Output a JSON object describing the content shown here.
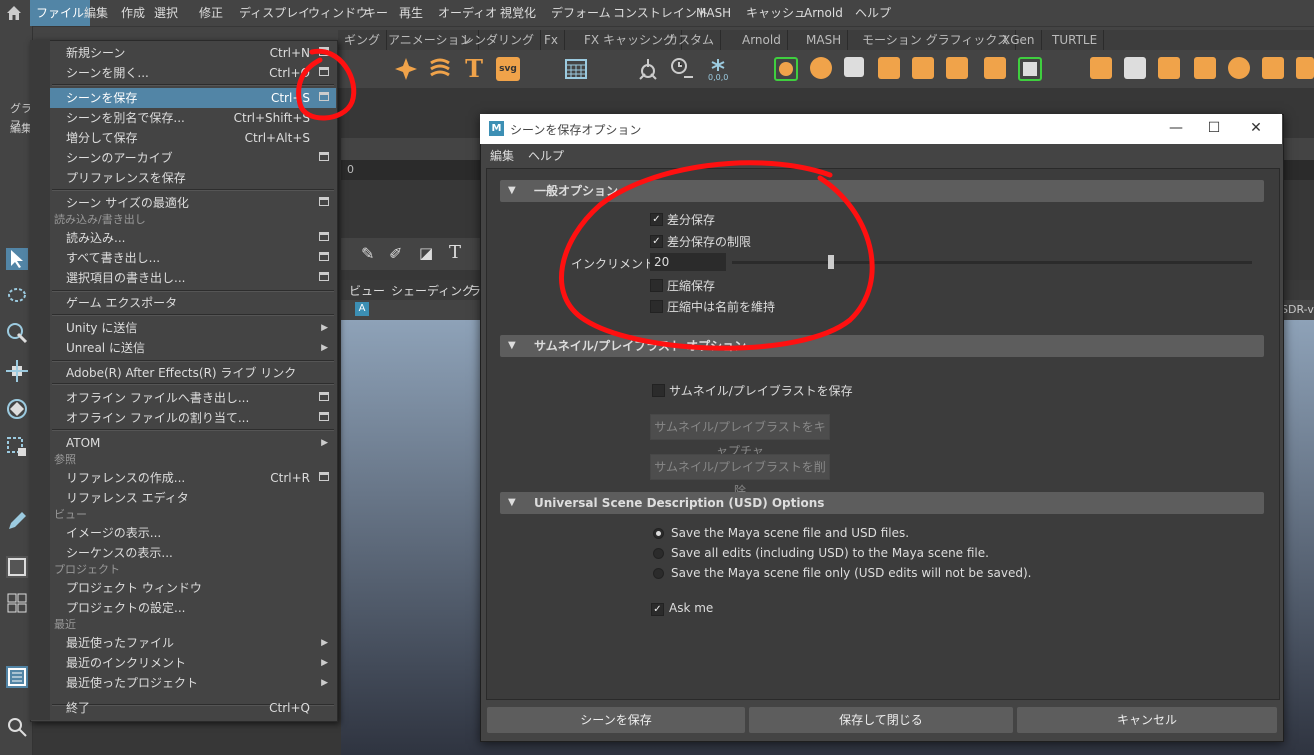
{
  "menubar": {
    "items": [
      "ファイル",
      "編集",
      "作成",
      "選択",
      "修正",
      "ディスプレイ",
      "ウィンドウ",
      "キー",
      "再生",
      "オーディオ",
      "視覚化",
      "デフォーム",
      "コンストレイント",
      "MASH",
      "キャッシュ",
      "Arnold",
      "ヘルプ"
    ]
  },
  "shelf_tabs": [
    "ギング",
    "アニメーション",
    "レンダリング",
    "Fx",
    "FX キャッシング",
    "カスタム",
    "Arnold",
    "MASH",
    "モーション グラフィックス",
    "XGen",
    "TURTLE"
  ],
  "side_labels": {
    "graph": "グラフ",
    "edit": "編集"
  },
  "viewport": {
    "menu_view": "ビュー",
    "menu_shading": "シェーディング",
    "menu_light": "ライ",
    "sdr": "SDR-v",
    "time": "0"
  },
  "file_menu": {
    "items": [
      {
        "label": "新規シーン",
        "shortcut": "Ctrl+N",
        "option": true
      },
      {
        "label": "シーンを開く...",
        "shortcut": "Ctrl+O",
        "option": true
      },
      {
        "label": "シーンを保存",
        "shortcut": "Ctrl+S",
        "option": true
      },
      {
        "label": "シーンを別名で保存...",
        "shortcut": "Ctrl+Shift+S",
        "option": false
      },
      {
        "label": "増分して保存",
        "shortcut": "Ctrl+Alt+S",
        "option": false
      },
      {
        "label": "シーンのアーカイブ",
        "shortcut": "",
        "option": true
      },
      {
        "label": "プリファレンスを保存",
        "shortcut": "",
        "option": false
      },
      {
        "label": "シーン サイズの最適化",
        "shortcut": "",
        "option": true
      },
      {
        "label": "読み込み...",
        "shortcut": "",
        "option": true
      },
      {
        "label": "すべて書き出し...",
        "shortcut": "",
        "option": true
      },
      {
        "label": "選択項目の書き出し...",
        "shortcut": "",
        "option": true
      },
      {
        "label": "ゲーム エクスポータ",
        "shortcut": "",
        "option": false
      },
      {
        "label": "Unity に送信",
        "shortcut": "",
        "option": false
      },
      {
        "label": "Unreal に送信",
        "shortcut": "",
        "option": false
      },
      {
        "label": "Adobe(R) After Effects(R) ライブ リンク",
        "shortcut": "",
        "option": false
      },
      {
        "label": "オフライン ファイルへ書き出し...",
        "shortcut": "",
        "option": true
      },
      {
        "label": "オフライン ファイルの割り当て...",
        "shortcut": "",
        "option": true
      },
      {
        "label": "ATOM",
        "shortcut": "",
        "option": false
      },
      {
        "label": "リファレンスの作成...",
        "shortcut": "Ctrl+R",
        "option": true
      },
      {
        "label": "リファレンス エディタ",
        "shortcut": "",
        "option": false
      },
      {
        "label": "イメージの表示...",
        "shortcut": "",
        "option": false
      },
      {
        "label": "シーケンスの表示...",
        "shortcut": "",
        "option": false
      },
      {
        "label": "プロジェクト ウィンドウ",
        "shortcut": "",
        "option": false
      },
      {
        "label": "プロジェクトの設定...",
        "shortcut": "",
        "option": false
      },
      {
        "label": "最近使ったファイル",
        "shortcut": "",
        "option": false
      },
      {
        "label": "最近のインクリメント",
        "shortcut": "",
        "option": false
      },
      {
        "label": "最近使ったプロジェクト",
        "shortcut": "",
        "option": false
      },
      {
        "label": "終了",
        "shortcut": "Ctrl+Q",
        "option": false
      }
    ],
    "sections": [
      "読み込み/書き出し",
      "参照",
      "ビュー",
      "プロジェクト",
      "最近"
    ]
  },
  "dialog": {
    "title": "シーンを保存オプション",
    "menu": [
      "編集",
      "ヘルプ"
    ],
    "general_header": "一般オプション",
    "incremental_save": "差分保存",
    "limit_incremental": "差分保存の制限",
    "increment_label": "インクリメント数:",
    "increment_value": "20",
    "increment_fraction": 0.19,
    "compressed_save": "圧縮保存",
    "keep_name": "圧縮中は名前を維持",
    "thumbnail_header": "サムネイル/プレイブラスト オプション",
    "save_thumbnail": "サムネイル/プレイブラストを保存",
    "capture_btn": "サムネイル/プレイブラストをキャプチャ",
    "delete_btn": "サムネイル/プレイブラストを削除",
    "usd_header": "Universal Scene Description (USD) Options",
    "usd_opt1": "Save the Maya scene file and USD files.",
    "usd_opt2": "Save all edits (including USD) to the Maya scene file.",
    "usd_opt3": "Save the Maya scene file only (USD edits will not be saved).",
    "ask_me": "Ask me",
    "btn_save": "シーンを保存",
    "btn_save_close": "保存して閉じる",
    "btn_cancel": "キャンセル",
    "check_mark": "✓",
    "annotation_color": "#ff1010"
  }
}
